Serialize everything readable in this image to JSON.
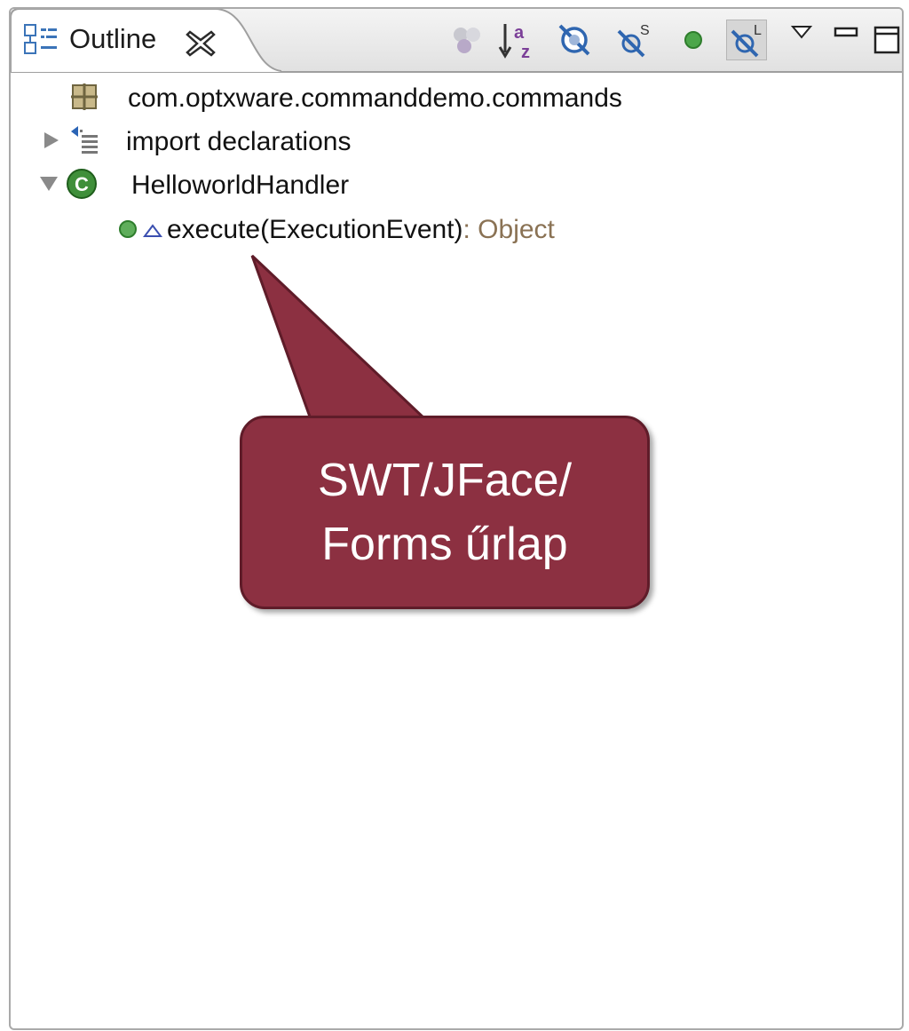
{
  "view": {
    "title": "Outline",
    "icon": "outline-view-icon",
    "close_icon": "close-tab-icon"
  },
  "toolbar": [
    {
      "name": "hide-non-public-members-icon",
      "pressed": false
    },
    {
      "name": "sort-icon",
      "pressed": false
    },
    {
      "name": "hide-fields-icon",
      "pressed": false
    },
    {
      "name": "hide-static-members-icon",
      "pressed": false
    },
    {
      "name": "hide-non-public-green-icon",
      "pressed": false
    },
    {
      "name": "hide-local-types-icon",
      "pressed": true
    },
    {
      "name": "view-menu-icon",
      "pressed": false
    },
    {
      "name": "minimize-icon",
      "pressed": false
    },
    {
      "name": "maximize-icon",
      "pressed": false
    }
  ],
  "tree": [
    {
      "label": "com.optxware.commanddemo.commands",
      "icon": "package-icon",
      "expander": "none"
    },
    {
      "label": "import declarations",
      "icon": "imports-icon",
      "expander": "collapsed"
    },
    {
      "label": "HelloworldHandler",
      "icon": "class-icon",
      "expander": "expanded"
    },
    {
      "label": "execute(ExecutionEvent)",
      "type_suffix": " : Object",
      "icon": "public-method-icon",
      "overlay": "override-icon",
      "expander": "none"
    }
  ],
  "callout": {
    "line1": "SWT/JFace/",
    "line2": "Forms űrlap",
    "fill": "#8c3041"
  }
}
